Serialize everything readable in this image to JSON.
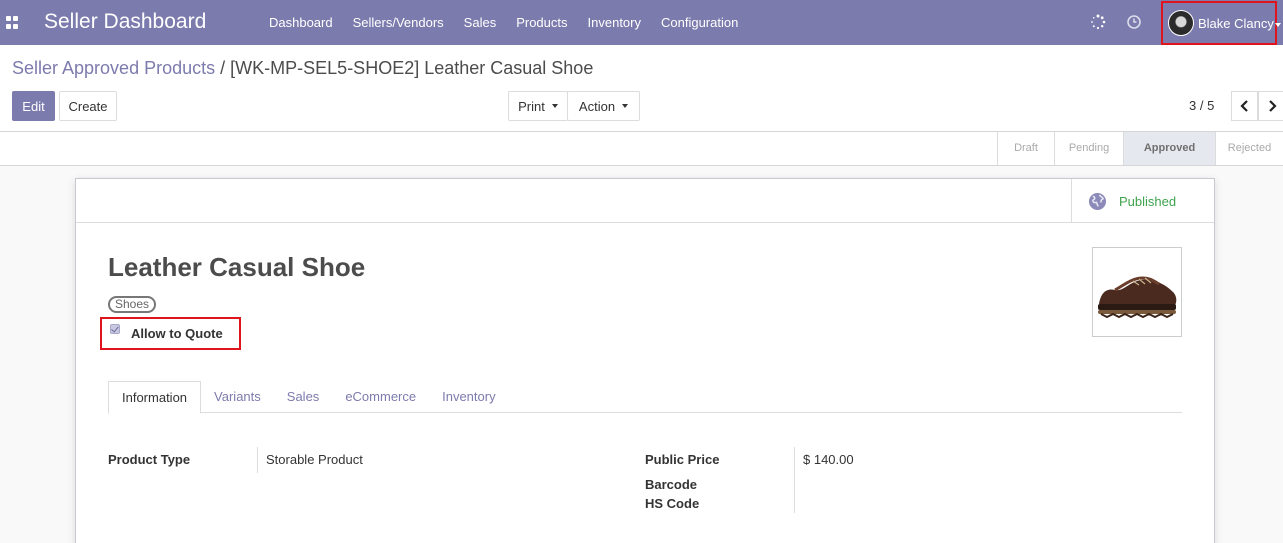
{
  "navbar": {
    "brand": "Seller Dashboard",
    "menu": [
      "Dashboard",
      "Sellers/Vendors",
      "Sales",
      "Products",
      "Inventory",
      "Configuration"
    ],
    "user_name": "Blake Clancy",
    "accent": "#7c7bad"
  },
  "breadcrumb": {
    "parent": "Seller Approved Products",
    "separator": "/",
    "current": "[WK-MP-SEL5-SHOE2] Leather Casual Shoe"
  },
  "toolbar": {
    "edit_label": "Edit",
    "create_label": "Create",
    "print_label": "Print",
    "action_label": "Action"
  },
  "pager": {
    "value": "3 / 5"
  },
  "statusbar": {
    "stages": [
      "Draft",
      "Pending",
      "Approved",
      "Rejected"
    ],
    "active": "Approved"
  },
  "form": {
    "published_label": "Published",
    "product_name": "Leather Casual Shoe",
    "tag": "Shoes",
    "allow_quote_label": "Allow to Quote",
    "allow_quote_checked": true,
    "tabs": [
      "Information",
      "Variants",
      "Sales",
      "eCommerce",
      "Inventory"
    ],
    "active_tab": "Information",
    "fields": {
      "product_type_label": "Product Type",
      "product_type_value": "Storable Product",
      "public_price_label": "Public Price",
      "public_price_value": "$ 140.00",
      "barcode_label": "Barcode",
      "hs_code_label": "HS Code"
    }
  },
  "icons": {
    "apps": "apps-grid-icon",
    "activity": "spinner-icon",
    "clock": "clock-icon",
    "globe": "globe-icon"
  },
  "colors": {
    "navbar": "#7c7bad",
    "highlight": "#e0141c",
    "published": "#3fa34d"
  }
}
